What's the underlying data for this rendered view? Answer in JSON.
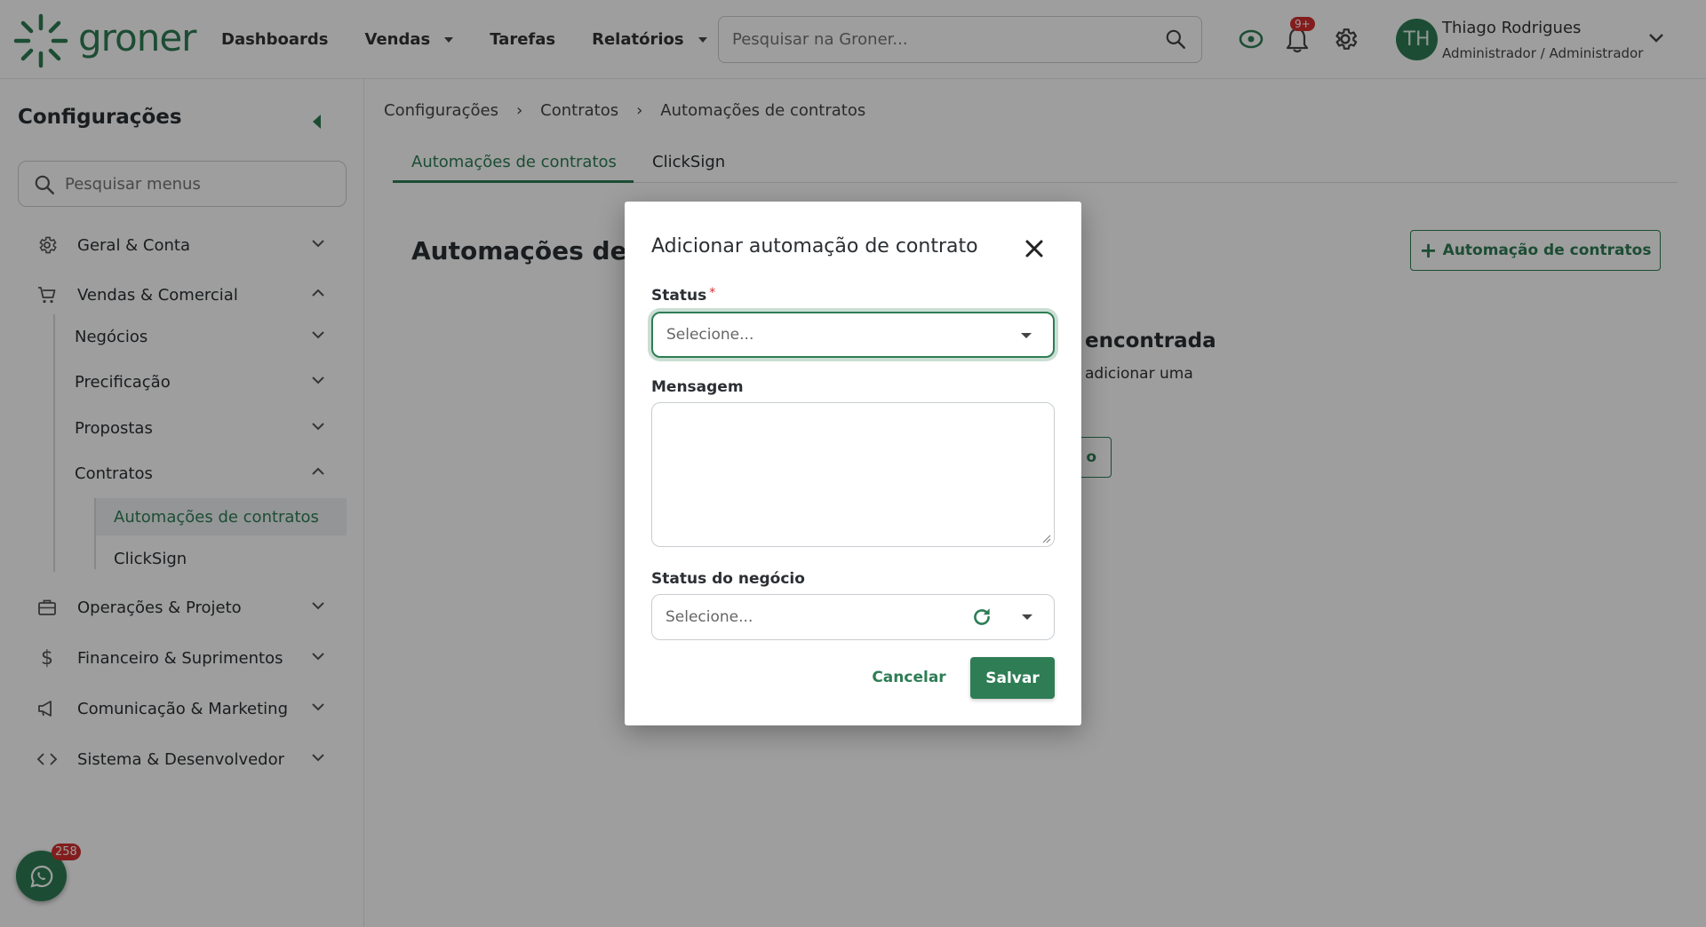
{
  "app": {
    "logo_text": "groner"
  },
  "nav": {
    "items": [
      {
        "label": "Dashboards"
      },
      {
        "label": "Vendas"
      },
      {
        "label": "Tarefas"
      },
      {
        "label": "Relatórios"
      }
    ]
  },
  "search": {
    "placeholder": "Pesquisar na Groner..."
  },
  "notifications": {
    "badge": "9+"
  },
  "user": {
    "initials": "TH",
    "name": "Thiago Rodrigues",
    "role": "Administrador / Administrador"
  },
  "sidebar": {
    "title": "Configurações",
    "search_placeholder": "Pesquisar menus",
    "sections": [
      {
        "label": "Geral & Conta",
        "icon": "gear-icon"
      },
      {
        "label": "Vendas & Comercial",
        "icon": "cart-icon"
      },
      {
        "label": "Operações & Projeto",
        "icon": "briefcase-icon"
      },
      {
        "label": "Financeiro & Suprimentos",
        "icon": "dollar-icon"
      },
      {
        "label": "Comunicação & Marketing",
        "icon": "megaphone-icon"
      },
      {
        "label": "Sistema & Desenvolvedor",
        "icon": "code-icon"
      }
    ],
    "vendas_sub": [
      "Negócios",
      "Precificação",
      "Propostas",
      "Contratos"
    ],
    "contratos_sub": [
      "Automações de contratos",
      "ClickSign"
    ],
    "whatsapp_badge": "258"
  },
  "breadcrumb": [
    "Configurações",
    "Contratos",
    "Automações de contratos"
  ],
  "tabs": [
    "Automações de contratos",
    "ClickSign"
  ],
  "card": {
    "title": "Automações de contratos",
    "add_button": "Automação de contratos",
    "empty_title": "encontrada",
    "empty_sub": "adicionar uma",
    "empty_button": "o"
  },
  "modal": {
    "title": "Adicionar automação de contrato",
    "status_label": "Status",
    "status_placeholder": "Selecione...",
    "message_label": "Mensagem",
    "message_value": "",
    "deal_status_label": "Status do negócio",
    "deal_status_placeholder": "Selecione...",
    "cancel": "Cancelar",
    "save": "Salvar"
  },
  "colors": {
    "brand": "#2e7d55",
    "badge": "#d32f2f"
  }
}
